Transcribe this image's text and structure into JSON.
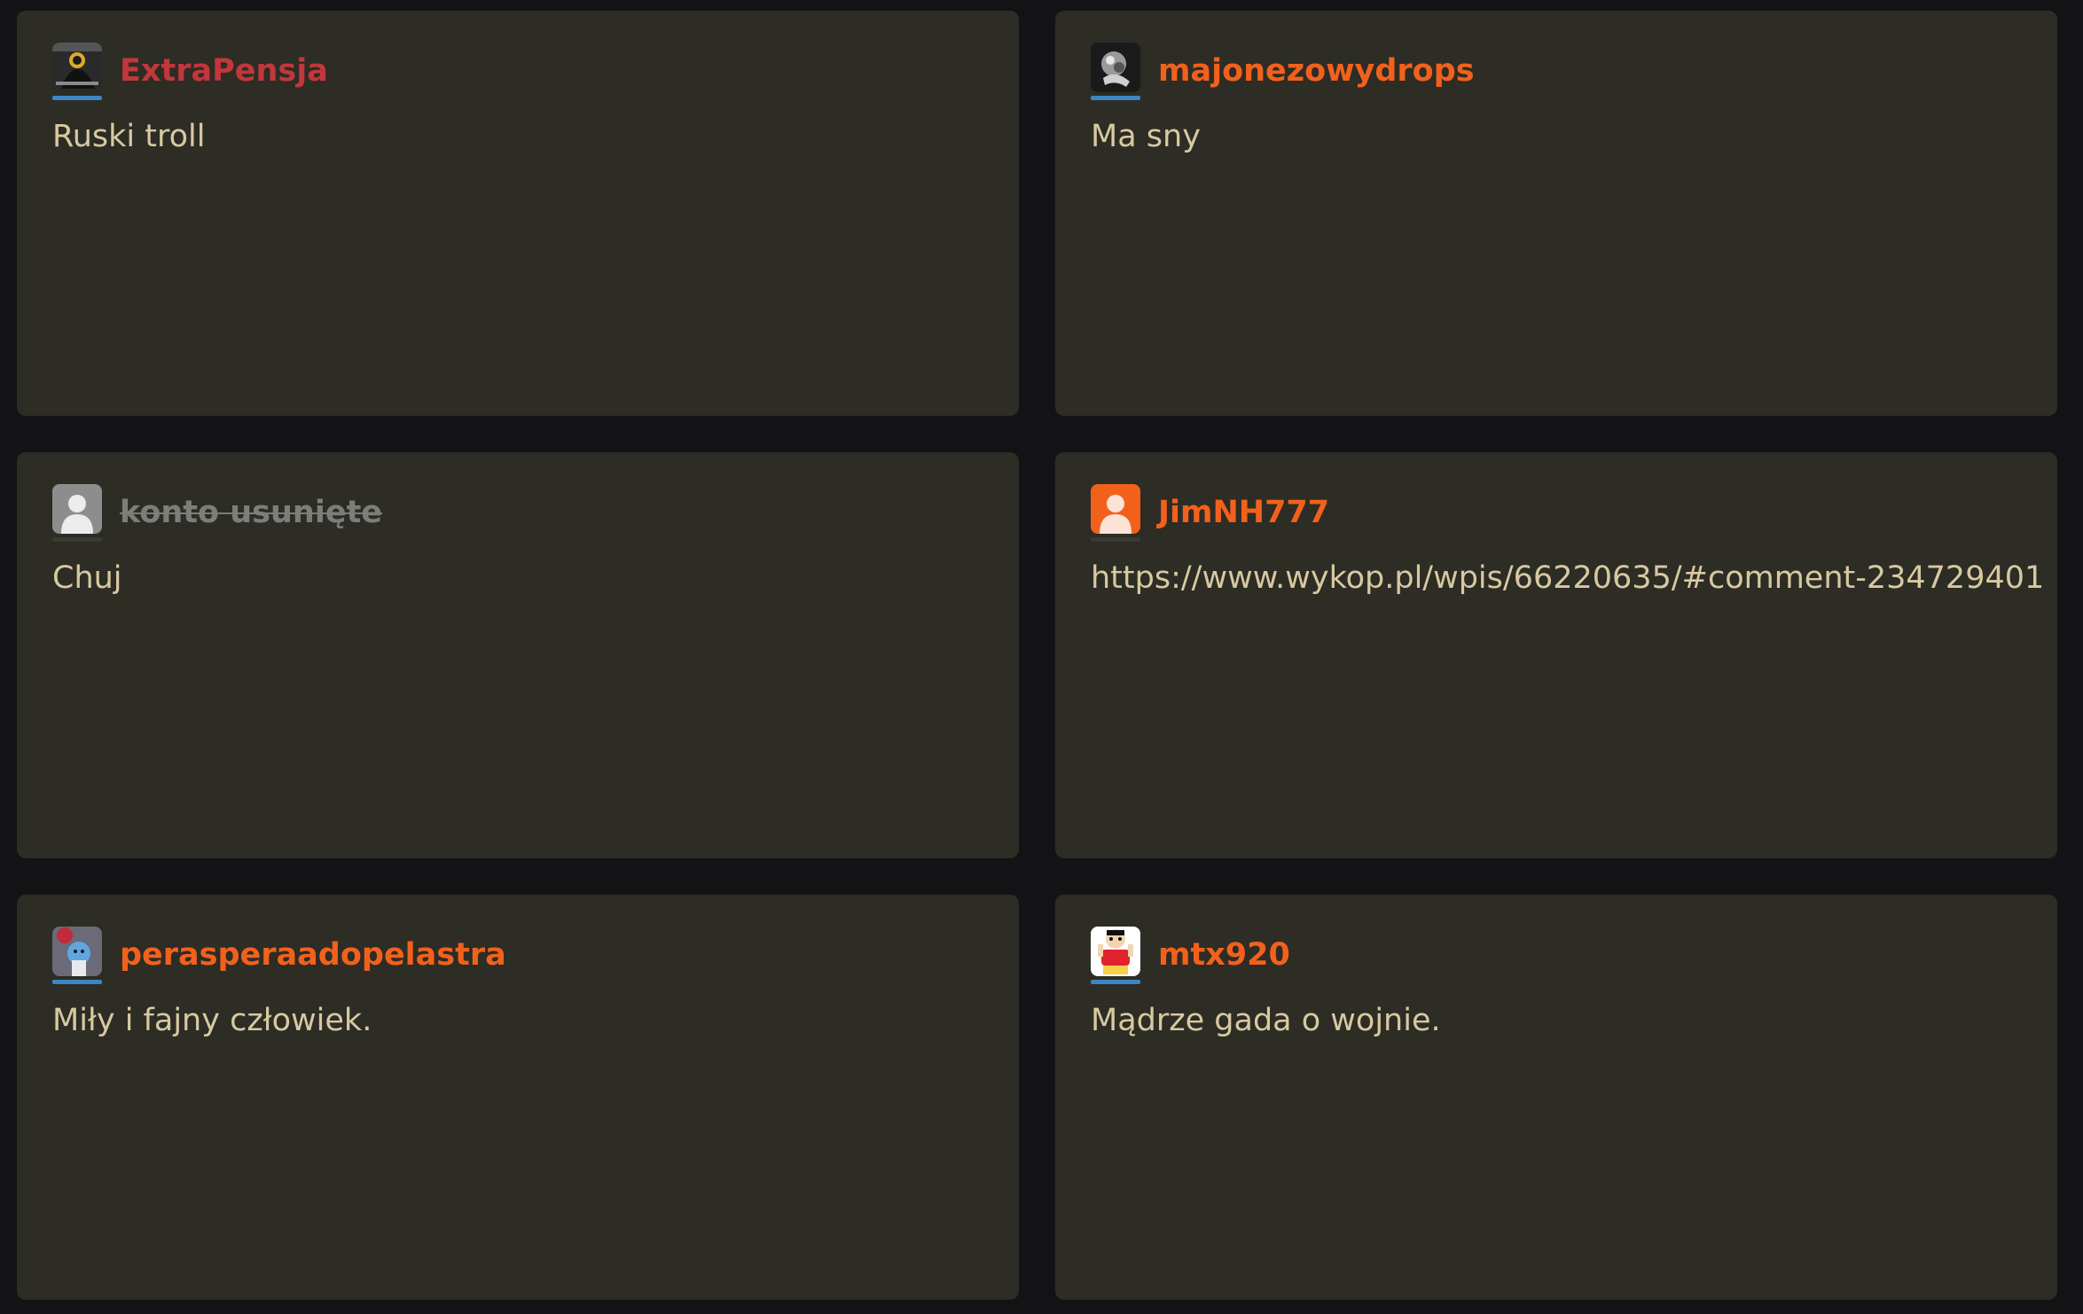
{
  "cards": [
    {
      "author": "ExtraPensja",
      "name_color": "#c2373b",
      "avatar_icon": "user-avatar-photo",
      "text": "Ruski troll"
    },
    {
      "author": "majonezowydrops",
      "name_color": "#f2611c",
      "avatar_icon": "user-avatar-photo",
      "text": "Ma sny"
    },
    {
      "author": "konto usunięte",
      "name_color": "#7d7d7b",
      "avatar_icon": "default-user-icon",
      "text": "Chuj"
    },
    {
      "author": "JimNH777",
      "name_color": "#f2611c",
      "avatar_icon": "default-user-icon",
      "text": "https://www.wykop.pl/wpis/66220635/#comment-234729401"
    },
    {
      "author": "perasperaadopelastra",
      "name_color": "#f2611c",
      "avatar_icon": "user-avatar-photo",
      "text": "Miły i fajny człowiek."
    },
    {
      "author": "mtx920",
      "name_color": "#f2611c",
      "avatar_icon": "user-avatar-photo",
      "text": "Mądrze gada o wojnie."
    }
  ],
  "colors": {
    "page_background": "#131316",
    "card_background": "#2d2c25",
    "body_text": "#d7c9a0",
    "avatar_underline": "#3c86c4"
  }
}
